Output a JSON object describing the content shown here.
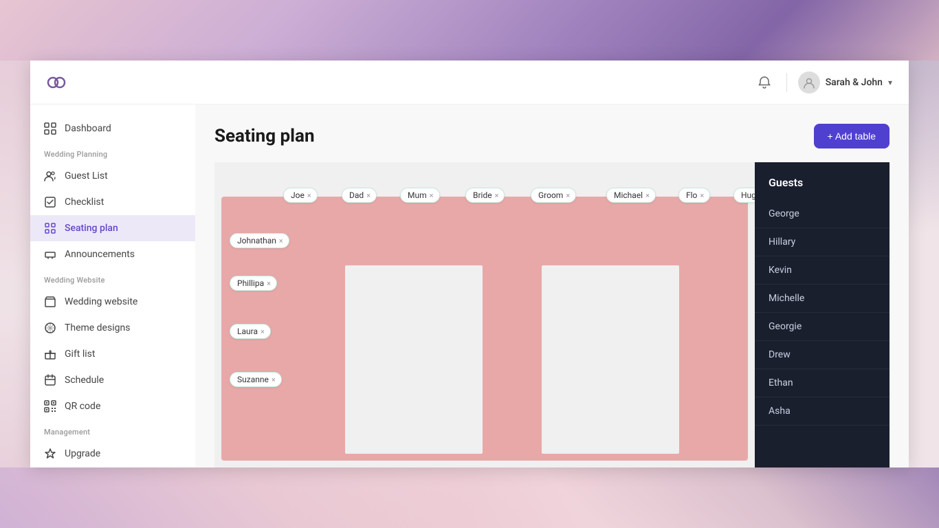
{
  "app": {
    "logo_alt": "Wedding rings logo"
  },
  "topbar": {
    "user_name": "Sarah & John",
    "chevron": "▾"
  },
  "sidebar": {
    "section_planning": "Wedding Planning",
    "section_website": "Wedding Website",
    "section_management": "Management",
    "nav_items": [
      {
        "id": "dashboard",
        "label": "Dashboard",
        "icon": "dashboard-icon",
        "active": false
      },
      {
        "id": "guest-list",
        "label": "Guest List",
        "icon": "guests-icon",
        "active": false,
        "section": "planning"
      },
      {
        "id": "checklist",
        "label": "Checklist",
        "icon": "checklist-icon",
        "active": false,
        "section": "planning"
      },
      {
        "id": "seating-plan",
        "label": "Seating plan",
        "icon": "seating-icon",
        "active": true,
        "section": "planning"
      },
      {
        "id": "announcements",
        "label": "Announcements",
        "icon": "announce-icon",
        "active": false,
        "section": "planning"
      },
      {
        "id": "wedding-website",
        "label": "Wedding website",
        "icon": "website-icon",
        "active": false,
        "section": "website"
      },
      {
        "id": "theme-designs",
        "label": "Theme designs",
        "icon": "theme-icon",
        "active": false,
        "section": "website"
      },
      {
        "id": "gift-list",
        "label": "Gift list",
        "icon": "gift-icon",
        "active": false,
        "section": "website"
      },
      {
        "id": "schedule",
        "label": "Schedule",
        "icon": "schedule-icon",
        "active": false,
        "section": "website"
      },
      {
        "id": "qr-code",
        "label": "QR code",
        "icon": "qr-icon",
        "active": false,
        "section": "website"
      },
      {
        "id": "upgrade",
        "label": "Upgrade",
        "icon": "upgrade-icon",
        "active": false,
        "section": "management"
      }
    ]
  },
  "page": {
    "title": "Seating plan",
    "add_table_label": "+ Add table"
  },
  "seating": {
    "top_guests": [
      {
        "name": "Joe"
      },
      {
        "name": "Dad"
      },
      {
        "name": "Mum"
      },
      {
        "name": "Bride"
      },
      {
        "name": "Groom"
      },
      {
        "name": "Michael"
      },
      {
        "name": "Flo"
      },
      {
        "name": "Hugo"
      }
    ],
    "left_guests": [
      {
        "name": "Johnathan"
      },
      {
        "name": "Phillipa"
      },
      {
        "name": "Laura"
      },
      {
        "name": "Suzanne"
      }
    ]
  },
  "guests_panel": {
    "title": "Guests",
    "items": [
      {
        "name": "George"
      },
      {
        "name": "Hillary"
      },
      {
        "name": "Kevin"
      },
      {
        "name": "Michelle"
      },
      {
        "name": "Georgie"
      },
      {
        "name": "Drew"
      },
      {
        "name": "Ethan"
      },
      {
        "name": "Asha"
      }
    ]
  }
}
